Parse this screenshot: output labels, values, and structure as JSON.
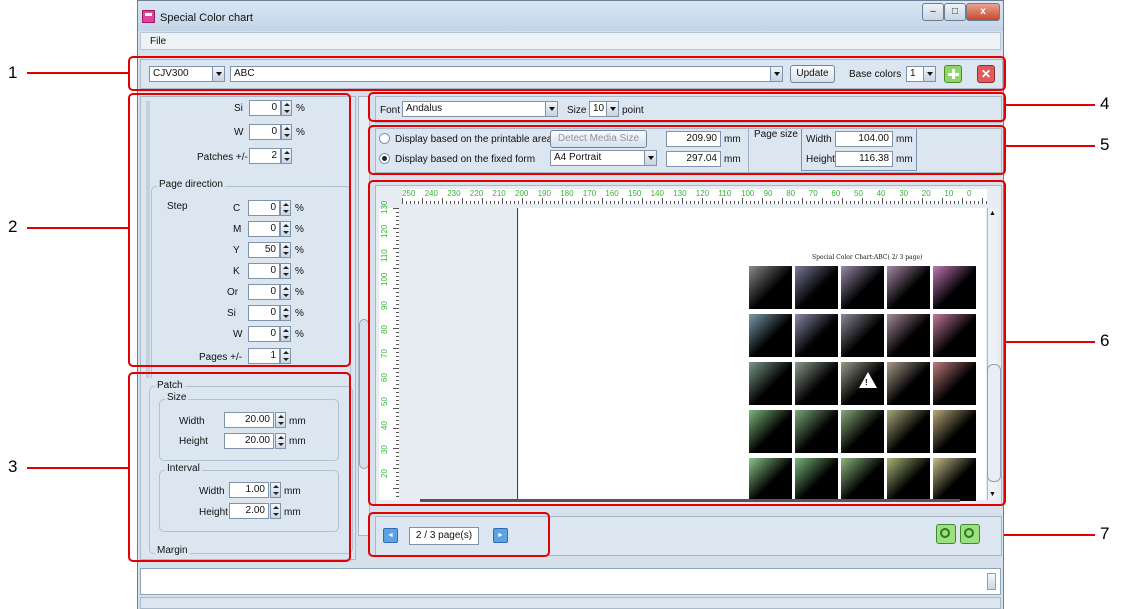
{
  "window": {
    "title": "Special Color chart",
    "minimize": "–",
    "maximize": "□",
    "close": "x"
  },
  "menu": {
    "file": "File"
  },
  "toolbar": {
    "printer": "CJV300",
    "name": "ABC",
    "update": "Update",
    "base_colors_label": "Base colors",
    "base_colors_value": "1"
  },
  "left_panel": {
    "si_label": "Si",
    "si_value": "0",
    "si_unit": "%",
    "w_label": "W",
    "w_value": "0",
    "w_unit": "%",
    "patches_label": "Patches +/-",
    "patches_value": "2",
    "page_direction": {
      "title": "Page direction",
      "step_label": "Step",
      "rows": [
        {
          "label": "C",
          "value": "0",
          "unit": "%"
        },
        {
          "label": "M",
          "value": "0",
          "unit": "%"
        },
        {
          "label": "Y",
          "value": "50",
          "unit": "%"
        },
        {
          "label": "K",
          "value": "0",
          "unit": "%"
        },
        {
          "label": "Or",
          "value": "0",
          "unit": "%"
        },
        {
          "label": "Si",
          "value": "0",
          "unit": "%"
        },
        {
          "label": "W",
          "value": "0",
          "unit": "%"
        }
      ],
      "pages_label": "Pages +/-",
      "pages_value": "1"
    }
  },
  "patch_panel": {
    "title": "Patch",
    "size": {
      "title": "Size",
      "width_label": "Width",
      "width_value": "20.00",
      "height_label": "Height",
      "height_value": "20.00",
      "unit": "mm"
    },
    "interval": {
      "title": "Interval",
      "width_label": "Width",
      "width_value": "1.00",
      "height_label": "Height",
      "height_value": "2.00",
      "unit": "mm"
    },
    "margin_title": "Margin"
  },
  "font_bar": {
    "font_label": "Font",
    "font_value": "Andalus",
    "size_label": "Size",
    "size_value": "10",
    "size_unit": "point"
  },
  "display": {
    "printable_label": "Display based on the printable area",
    "detect_button": "Detect Media Size",
    "fixed_label": "Display based on the fixed form",
    "form_value": "A4 Portrait",
    "width_mm": "209.90",
    "height_mm": "297.04",
    "mm": "mm",
    "page_size_title": "Page size",
    "ps_width_label": "Width",
    "ps_width_value": "104.00",
    "ps_height_label": "Height",
    "ps_height_value": "116.38"
  },
  "preview": {
    "chart_title": "Special Color Chart:ABC( 2/ 3 page)",
    "ruler_top": [
      "250",
      "240",
      "230",
      "220",
      "210",
      "200",
      "190",
      "180",
      "170",
      "160",
      "150",
      "140",
      "130",
      "120",
      "110",
      "100",
      "90",
      "80",
      "70",
      "60",
      "50",
      "40",
      "30",
      "20",
      "10",
      "0"
    ],
    "ruler_left": [
      "130",
      "120",
      "110",
      "100",
      "90",
      "80",
      "70",
      "60",
      "50",
      "40",
      "30",
      "20"
    ],
    "warning_mark": "!",
    "patch_colors": [
      [
        "#8a8a8a",
        "#7a7a9a",
        "#9a8aa8",
        "#a88aa8",
        "#c07ab8"
      ],
      [
        "#7a9aa8",
        "#8a8aa8",
        "#8a8a9a",
        "#a88a9a",
        "#c07a9a"
      ],
      [
        "#7a9a8a",
        "#8a9a8a",
        "#9a9a8a",
        "#a89a8a",
        "#c07a7a"
      ],
      [
        "#7ab87a",
        "#7aa87a",
        "#8aa87a",
        "#a8a87a",
        "#b8a87a"
      ],
      [
        "#8ac88a",
        "#7ab87a",
        "#8ab87a",
        "#a8b87a",
        "#c8c08a"
      ]
    ]
  },
  "navigation": {
    "prev": "◄",
    "page": "2 / 3 page(s)",
    "next": "►"
  },
  "callouts": [
    "1",
    "2",
    "3",
    "4",
    "5",
    "6",
    "7"
  ]
}
